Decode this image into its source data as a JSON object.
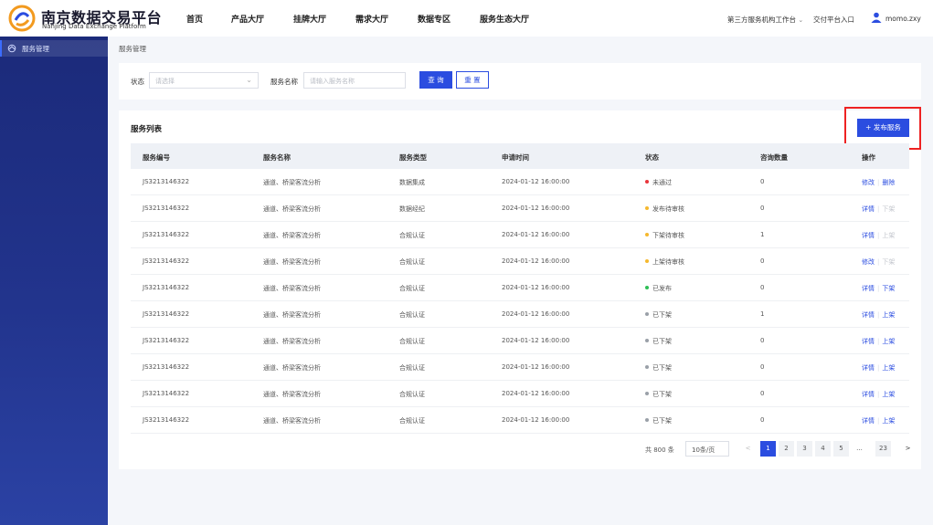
{
  "header": {
    "brand_cn": "南京数据交易平台",
    "brand_en": "Nanjing Data Exchange Platform",
    "nav": [
      "首页",
      "产品大厅",
      "挂牌大厅",
      "需求大厅",
      "数据专区",
      "服务生态大厅"
    ],
    "workbench": "第三方服务机构工作台",
    "delivery": "交付平台入口",
    "username": "momo.zxy"
  },
  "sidebar": {
    "items": [
      {
        "label": "服务管理",
        "icon": "service-icon"
      }
    ]
  },
  "breadcrumb": "服务管理",
  "filter": {
    "status_label": "状态",
    "status_placeholder": "请选择",
    "name_label": "服务名称",
    "name_placeholder": "请输入服务名称",
    "query_label": "查 询",
    "reset_label": "重 置"
  },
  "list": {
    "title": "服务列表",
    "publish_label": "+ 发布服务",
    "columns": [
      "服务编号",
      "服务名称",
      "服务类型",
      "申请时间",
      "状态",
      "咨询数量",
      "操作"
    ],
    "rows": [
      {
        "id": "JS3213146322",
        "name": "通道、桥梁客流分析",
        "type": "数据集成",
        "time": "2024-01-12 16:00:00",
        "status": "未通过",
        "status_color": "#e8353b",
        "count": "0",
        "op1": "修改",
        "op2": "删除",
        "op2_enabled": true
      },
      {
        "id": "JS3213146322",
        "name": "通道、桥梁客流分析",
        "type": "数据经纪",
        "time": "2024-01-12 16:00:00",
        "status": "发布待审核",
        "status_color": "#f5b82e",
        "count": "0",
        "op1": "详情",
        "op2": "下架",
        "op2_enabled": false
      },
      {
        "id": "JS3213146322",
        "name": "通道、桥梁客流分析",
        "type": "合规认证",
        "time": "2024-01-12 16:00:00",
        "status": "下架待审核",
        "status_color": "#f5b82e",
        "count": "1",
        "op1": "详情",
        "op2": "上架",
        "op2_enabled": false
      },
      {
        "id": "JS3213146322",
        "name": "通道、桥梁客流分析",
        "type": "合规认证",
        "time": "2024-01-12 16:00:00",
        "status": "上架待审核",
        "status_color": "#f5b82e",
        "count": "0",
        "op1": "修改",
        "op2": "下架",
        "op2_enabled": false
      },
      {
        "id": "JS3213146322",
        "name": "通道、桥梁客流分析",
        "type": "合规认证",
        "time": "2024-01-12 16:00:00",
        "status": "已发布",
        "status_color": "#2fbf56",
        "count": "0",
        "op1": "详情",
        "op2": "下架",
        "op2_enabled": true
      },
      {
        "id": "JS3213146322",
        "name": "通道、桥梁客流分析",
        "type": "合规认证",
        "time": "2024-01-12 16:00:00",
        "status": "已下架",
        "status_color": "#9aa0a8",
        "count": "1",
        "op1": "详情",
        "op2": "上架",
        "op2_enabled": true
      },
      {
        "id": "JS3213146322",
        "name": "通道、桥梁客流分析",
        "type": "合规认证",
        "time": "2024-01-12 16:00:00",
        "status": "已下架",
        "status_color": "#9aa0a8",
        "count": "0",
        "op1": "详情",
        "op2": "上架",
        "op2_enabled": true
      },
      {
        "id": "JS3213146322",
        "name": "通道、桥梁客流分析",
        "type": "合规认证",
        "time": "2024-01-12 16:00:00",
        "status": "已下架",
        "status_color": "#9aa0a8",
        "count": "0",
        "op1": "详情",
        "op2": "上架",
        "op2_enabled": true
      },
      {
        "id": "JS3213146322",
        "name": "通道、桥梁客流分析",
        "type": "合规认证",
        "time": "2024-01-12 16:00:00",
        "status": "已下架",
        "status_color": "#9aa0a8",
        "count": "0",
        "op1": "详情",
        "op2": "上架",
        "op2_enabled": true
      },
      {
        "id": "JS3213146322",
        "name": "通道、桥梁客流分析",
        "type": "合规认证",
        "time": "2024-01-12 16:00:00",
        "status": "已下架",
        "status_color": "#9aa0a8",
        "count": "0",
        "op1": "详情",
        "op2": "上架",
        "op2_enabled": true
      }
    ]
  },
  "pagination": {
    "total": "共 800 条",
    "page_size": "10条/页",
    "prev": "<",
    "pages": [
      "1",
      "2",
      "3",
      "4",
      "5",
      "...",
      "23"
    ],
    "active_page": "1",
    "next": ">"
  },
  "colors": {
    "primary": "#2b4de0",
    "highlight": "#e22222",
    "sidebar": "#1b2a7a"
  }
}
